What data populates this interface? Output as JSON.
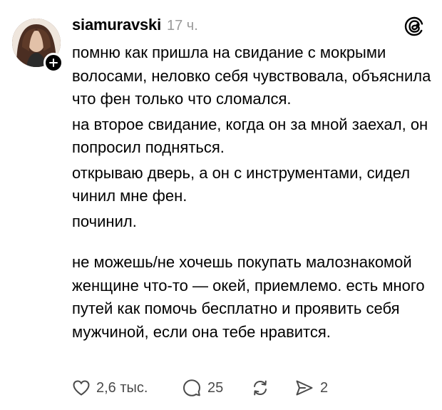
{
  "post": {
    "username": "siamuravski",
    "time": "17 ч.",
    "paragraphs": [
      "помню как пришла на свидание с мокрыми волосами, неловко себя чувствовала, объяснила что фен только что сломался.",
      "на второе свидание, когда он за мной заехал, он попросил подняться.",
      "открываю дверь, а он с инструментами, сидел чинил мне фен.",
      "починил.",
      "не можешь/не хочешь покупать малознакомой женщине что-то — окей, приемлемо. есть много путей как помочь бесплатно и проявить себя мужчиной, если она тебе нравится."
    ]
  },
  "actions": {
    "likes": "2,6 тыс.",
    "replies": "25",
    "shares": "2"
  },
  "icons": {
    "app": "threads-icon",
    "follow": "plus-icon",
    "like": "heart-icon",
    "reply": "comment-icon",
    "repost": "repost-icon",
    "share": "send-icon"
  },
  "colors": {
    "text": "#000000",
    "muted": "#9a9a9a",
    "action_text": "#4a4a4a",
    "badge": "#000000"
  }
}
